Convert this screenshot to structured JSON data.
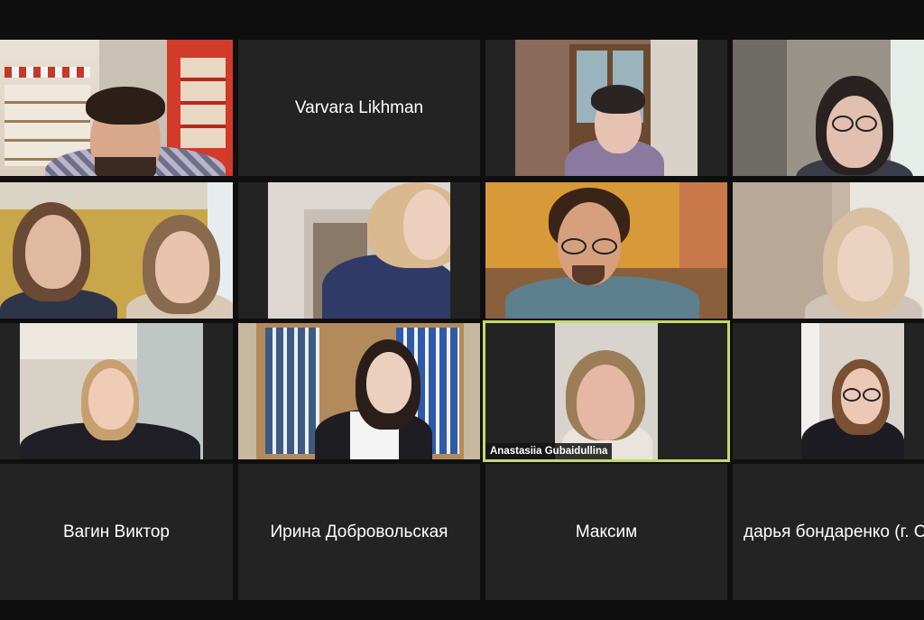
{
  "participants": [
    {
      "name": "",
      "has_video": true
    },
    {
      "name": "Varvara Likhman",
      "has_video": false
    },
    {
      "name": "",
      "has_video": true
    },
    {
      "name": "",
      "has_video": true
    },
    {
      "name": "",
      "has_video": true
    },
    {
      "name": "",
      "has_video": true
    },
    {
      "name": "",
      "has_video": true
    },
    {
      "name": "",
      "has_video": true
    },
    {
      "name": "",
      "has_video": true
    },
    {
      "name": "",
      "has_video": true
    },
    {
      "name": "Anastasiia Gubaidullina",
      "has_video": true,
      "speaking": true
    },
    {
      "name": "",
      "has_video": true
    },
    {
      "name": "Вагин Виктор",
      "has_video": false
    },
    {
      "name": "Ирина Добровольская",
      "has_video": false
    },
    {
      "name": "Максим",
      "has_video": false
    },
    {
      "name": "дарья бондаренко (г. С",
      "has_video": false
    }
  ],
  "colors": {
    "background": "#0f0f0f",
    "tile": "#232323",
    "active_speaker_border": "#c5d96a",
    "name_text": "#ffffff"
  }
}
